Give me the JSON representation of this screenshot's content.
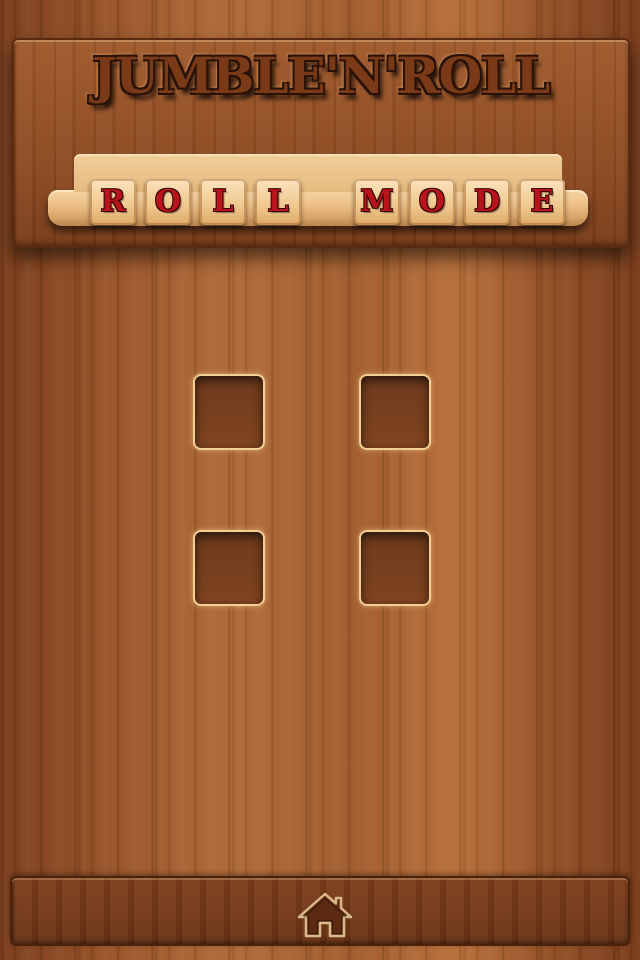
{
  "header": {
    "title": "JUMBLE'N'ROLL",
    "mode_word_1": [
      "R",
      "O",
      "L",
      "L"
    ],
    "mode_word_2": [
      "M",
      "O",
      "D",
      "E"
    ]
  },
  "slots": {
    "count": 4,
    "filled": 0
  },
  "footer": {
    "home_icon": "home-icon"
  },
  "colors": {
    "wood_dark": "#7a3d1b",
    "wood_light": "#b06a38",
    "tile_face": "#f0c991",
    "tile_letter": "#b8141b",
    "slot_border": "#f3cf95"
  }
}
